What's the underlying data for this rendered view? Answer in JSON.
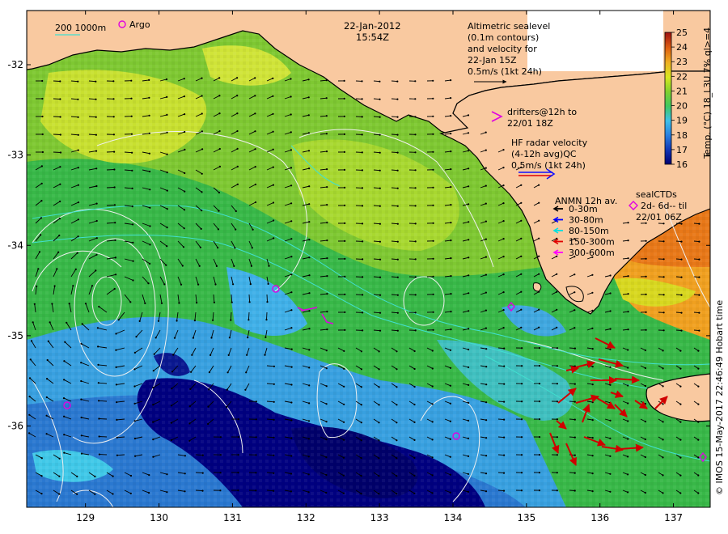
{
  "header": {
    "date": "22-Jan-2012",
    "time": "15:54Z"
  },
  "scale_legend": {
    "label": "200  1000m"
  },
  "argo_legend": {
    "label": "Argo"
  },
  "altimetry_note": {
    "lines": [
      "Altimetric sealevel",
      "(0.1m contours)",
      "and velocity for",
      "22-Jan 15Z",
      "0.5m/s (1kt 24h)"
    ]
  },
  "drifters_note": {
    "lines": [
      "drifters@12h to",
      "22/01 18Z"
    ]
  },
  "hf_radar_note": {
    "lines": [
      "HF radar velocity",
      "(4-12h avg)QC",
      "0.5m/s (1kt 24h)"
    ]
  },
  "anmn_legend": {
    "title": "ANMN 12h av.",
    "items": [
      {
        "label": "0-30m",
        "color": "#000000"
      },
      {
        "label": "30-80m",
        "color": "#0000ff"
      },
      {
        "label": "80-150m",
        "color": "#00e0e0"
      },
      {
        "label": "150-300m",
        "color": "#e00000"
      },
      {
        "label": "300-600m",
        "color": "#ff00ff"
      }
    ]
  },
  "sealctd_legend": {
    "lines": [
      "sealCTDs",
      "2d- 6d-- til",
      "22/01 06Z"
    ]
  },
  "colorbar": {
    "label": "Temp. (°C) 18_L3U 7% ql>=4",
    "ticks": [
      "16",
      "17",
      "18",
      "19",
      "20",
      "21",
      "22",
      "23",
      "24",
      "25"
    ],
    "range": [
      16,
      25
    ],
    "colors": [
      "#000070",
      "#1030b0",
      "#2a80e0",
      "#40c0e8",
      "#40c860",
      "#80d030",
      "#d8e820",
      "#f0b020",
      "#e06010",
      "#a01010"
    ]
  },
  "axes": {
    "x_ticks": [
      "129",
      "130",
      "131",
      "132",
      "133",
      "134",
      "135",
      "136",
      "137"
    ],
    "y_ticks": [
      "-32",
      "-33",
      "-34",
      "-35",
      "-36"
    ],
    "x_range": [
      128.2,
      137.5
    ],
    "y_range": [
      -36.9,
      -31.4
    ]
  },
  "colors": {
    "land": "#f9c9a0",
    "coast": "#000000",
    "contour": "#f0f0f0",
    "bathy": "#40e0d0",
    "argo": "#e000e0",
    "hf_radar_red": "#e00000",
    "hf_radar_blue": "#1010ff"
  },
  "credit": {
    "text": "© IMOS 15-May-2017 22:46:49 Hobart time"
  }
}
